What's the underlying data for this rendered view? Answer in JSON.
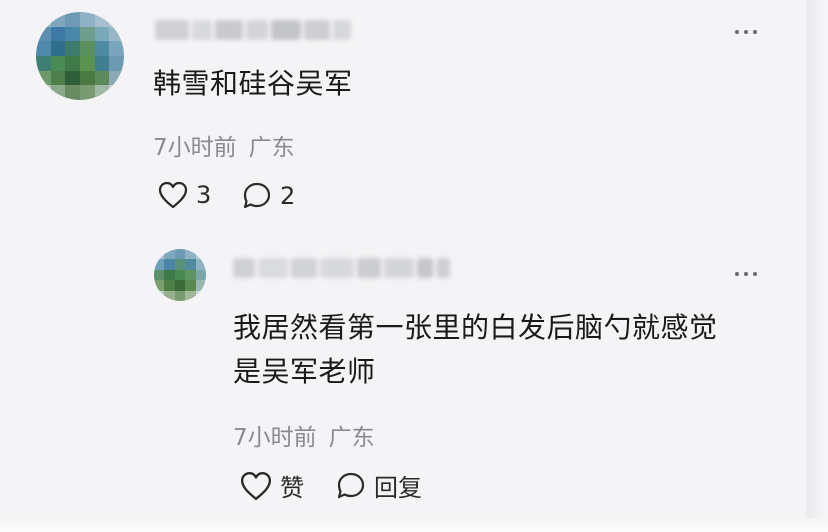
{
  "comment": {
    "text": "韩雪和硅谷吴军",
    "time": "7小时前",
    "location": "广东",
    "like_count": "3",
    "reply_count": "2"
  },
  "reply": {
    "text_line1": "我居然看第一张里的白发后脑勺就感觉",
    "text_line2": "是吴军老师",
    "time": "7小时前",
    "location": "广东",
    "like_label": "赞",
    "reply_label": "回复"
  },
  "icons": {
    "more": "more-horizontal-icon",
    "like": "heart-outline-icon",
    "comment": "speech-bubble-icon"
  },
  "colors": {
    "background": "#f4f4f6",
    "text": "#1a1a1a",
    "meta": "#8a8a90",
    "icon": "#2a2a2a"
  }
}
